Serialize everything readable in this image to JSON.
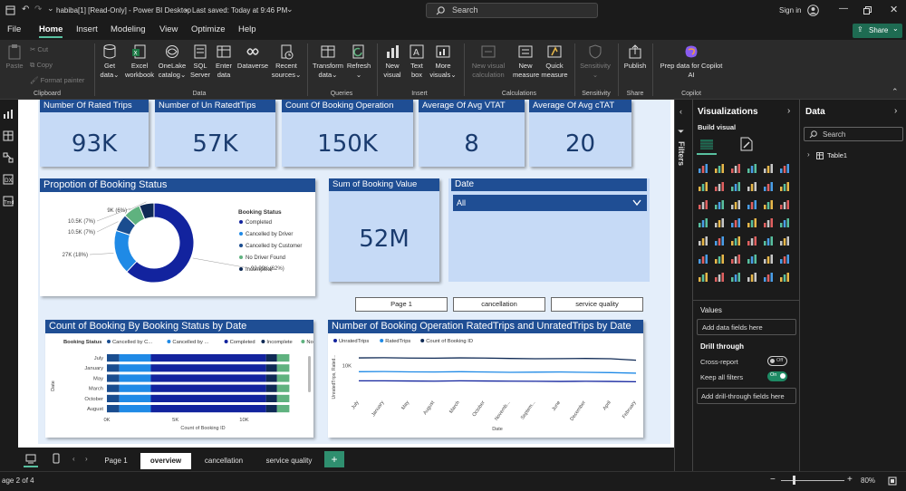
{
  "window": {
    "title": "habiba[1] [Read-Only] - Power BI Desktop",
    "save_status": "Last saved: Today at 9:46 PM",
    "search_placeholder": "Search",
    "sign_in": "Sign in",
    "share": "Share"
  },
  "menu": [
    "File",
    "Home",
    "Insert",
    "Modeling",
    "View",
    "Optimize",
    "Help"
  ],
  "ribbon": {
    "clipboard": {
      "paste": "Paste",
      "cut": "Cut",
      "copy": "Copy",
      "format_painter": "Format painter",
      "group": "Clipboard"
    },
    "data": {
      "get_data": [
        "Get",
        "data"
      ],
      "excel": [
        "Excel",
        "workbook"
      ],
      "onelake": [
        "OneLake",
        "catalog"
      ],
      "sql": [
        "SQL",
        "Server"
      ],
      "enter": [
        "Enter",
        "data"
      ],
      "dataverse": [
        "Dataverse"
      ],
      "recent": [
        "Recent",
        "sources"
      ],
      "group": "Data"
    },
    "queries": {
      "transform": [
        "Transform",
        "data"
      ],
      "refresh": [
        "Refresh"
      ],
      "group": "Queries"
    },
    "insert": {
      "new_visual": [
        "New",
        "visual"
      ],
      "text_box": [
        "Text",
        "box"
      ],
      "more_visuals": [
        "More",
        "visuals"
      ],
      "group": "Insert"
    },
    "calculations": {
      "new_visual_calc": [
        "New visual",
        "calculation"
      ],
      "new_measure": [
        "New",
        "measure"
      ],
      "quick_measure": [
        "Quick",
        "measure"
      ],
      "group": "Calculations"
    },
    "sensitivity": {
      "label": [
        "Sensitivity"
      ],
      "group": "Sensitivity"
    },
    "share": {
      "publish": [
        "Publish"
      ],
      "group": "Share"
    },
    "copilot": {
      "prep": [
        "Prep data for Copilot",
        "AI"
      ],
      "group": "Copilot"
    }
  },
  "kpis": [
    {
      "title": "Number Of Rated Trips",
      "value": "93K"
    },
    {
      "title": "Number of Un RatedtTips",
      "value": "57K"
    },
    {
      "title": "Count Of Booking Operation",
      "value": "150K"
    },
    {
      "title": "Average Of Avg VTAT",
      "value": "8"
    },
    {
      "title": "Average Of Avg cTAT",
      "value": "20"
    }
  ],
  "donut": {
    "title": "Propotion of Booking Status",
    "legend_title": "Booking Status",
    "slices": [
      {
        "label": "Completed",
        "value": 92.99,
        "text": "92.99K (62%)",
        "color": "#12239e"
      },
      {
        "label": "Cancelled by Driver",
        "value": 27,
        "text": "27K (18%)",
        "color": "#1f8ae6"
      },
      {
        "label": "Cancelled by Customer",
        "value": 10.5,
        "text": "10.5K (7%)",
        "color": "#1a4d8f"
      },
      {
        "label": "No Driver Found",
        "value": 10.5,
        "text": "10.5K (7%)",
        "color": "#5fb27f"
      },
      {
        "label": "Incomplete",
        "value": 9,
        "text": "9K (6%)",
        "color": "#0f2a55"
      }
    ]
  },
  "sum_card": {
    "title": "Sum of Booking Value",
    "value": "52M"
  },
  "slicer": {
    "title": "Date",
    "selected": "All"
  },
  "nav_buttons": [
    "Page 1",
    "cancellation",
    "service quality"
  ],
  "stacked_bar": {
    "title": "Count of Booking By Booking Status by Date",
    "legend_title": "Booking Status",
    "legend": [
      "Cancelled by C...",
      "Cancelled by ...",
      "Completed",
      "Incomplete",
      "No Driver Found"
    ],
    "colors": [
      "#1a4d8f",
      "#1f8ae6",
      "#12239e",
      "#0f2a55",
      "#5fb27f"
    ],
    "categories": [
      "July",
      "January",
      "May",
      "March",
      "October",
      "August"
    ],
    "ylabel": "Date",
    "xlabel": "Count of Booking ID",
    "xticks": [
      "0K",
      "5K",
      "10K"
    ],
    "xmax": 14000,
    "series": [
      {
        "name": "Cancelled by C...",
        "values": [
          900,
          900,
          900,
          900,
          900,
          900
        ]
      },
      {
        "name": "Cancelled by ...",
        "values": [
          2300,
          2300,
          2300,
          2300,
          2300,
          2300
        ]
      },
      {
        "name": "Completed",
        "values": [
          8400,
          8400,
          8400,
          8400,
          8400,
          8400
        ]
      },
      {
        "name": "Incomplete",
        "values": [
          800,
          800,
          800,
          800,
          800,
          800
        ]
      },
      {
        "name": "No Driver Found",
        "values": [
          900,
          900,
          900,
          900,
          900,
          900
        ]
      }
    ]
  },
  "line_chart": {
    "title": "Number of Booking Operation RatedTrips and UnratedTrips by Date",
    "legend": [
      "UnratedTrips",
      "RatedTrips",
      "Count of Booking ID"
    ],
    "colors": [
      "#12239e",
      "#1f8ae6",
      "#0f2a55"
    ],
    "categories": [
      "July",
      "January",
      "May",
      "August",
      "March",
      "October",
      "Novemb...",
      "Septem...",
      "June",
      "December",
      "April",
      "February"
    ],
    "ylabel": "UnratedTrips, Rated...",
    "yticks": [
      "10K"
    ],
    "xlabel": "Date",
    "ymax": 16000,
    "series": [
      {
        "name": "Count of Booking ID",
        "values": [
          12600,
          12650,
          12550,
          12500,
          12600,
          12550,
          12400,
          12300,
          12350,
          12400,
          12300,
          11800
        ]
      },
      {
        "name": "RatedTrips",
        "values": [
          7900,
          7950,
          7850,
          7800,
          7900,
          7800,
          7700,
          7750,
          7800,
          7700,
          7600,
          7400
        ]
      },
      {
        "name": "UnratedTrips",
        "values": [
          4800,
          4800,
          4750,
          4700,
          4800,
          4750,
          4700,
          4650,
          4600,
          4650,
          4600,
          4500
        ]
      }
    ]
  },
  "filters_label": "Filters",
  "viz_pane": {
    "title": "Visualizations",
    "build_visual": "Build visual",
    "values": "Values",
    "add_data_fields": "Add data fields here",
    "drill_through": "Drill through",
    "cross_report": "Cross-report",
    "cross_report_state": "Off",
    "keep_filters": "Keep all filters",
    "keep_filters_state": "On",
    "add_drill": "Add drill-through fields here"
  },
  "data_pane": {
    "title": "Data",
    "search_placeholder": "Search",
    "tables": [
      "Table1"
    ]
  },
  "tabs": [
    "Page 1",
    "overview",
    "cancellation",
    "service quality"
  ],
  "status": {
    "page": "age 2 of 4",
    "zoom": "80%"
  }
}
